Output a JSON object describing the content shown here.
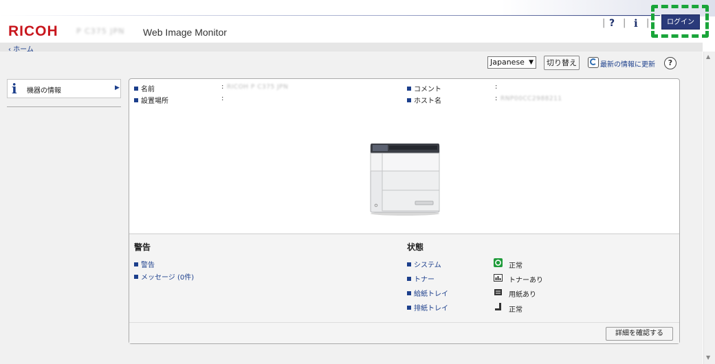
{
  "header": {
    "brand": "RICOH",
    "model": "P C375 JPN",
    "app_title": "Web Image Monitor",
    "help_label": "?",
    "info_label": "i",
    "login_label": "ログイン"
  },
  "breadcrumb": {
    "home": "‹ ホーム"
  },
  "toolbar": {
    "language_selected": "Japanese",
    "switch_label": "切り替え",
    "refresh_label": "最新の情報に更新",
    "help_label": "?"
  },
  "sidebar": {
    "items": [
      {
        "label": "機器の情報",
        "icon": "info-icon"
      }
    ]
  },
  "device": {
    "name_label": "名前",
    "name_value": "RICOH P C375 JPN",
    "location_label": "設置場所",
    "location_value": "",
    "comment_label": "コメント",
    "comment_value": "",
    "host_label": "ホスト名",
    "host_value": "RNP00CC2988211"
  },
  "alerts": {
    "title": "警告",
    "items": [
      "警告",
      "メッセージ (0件)"
    ]
  },
  "status": {
    "title": "状態",
    "rows": [
      {
        "label": "システム",
        "value": "正常",
        "icon": "system-ok-icon"
      },
      {
        "label": "トナー",
        "value": "トナーあり",
        "icon": "toner-icon"
      },
      {
        "label": "給紙トレイ",
        "value": "用紙あり",
        "icon": "paper-tray-icon"
      },
      {
        "label": "排紙トレイ",
        "value": "正常",
        "icon": "output-tray-icon"
      }
    ]
  },
  "details_button": "詳細を確認する",
  "colors": {
    "brand_red": "#c8161d",
    "navy": "#1c3f8c",
    "login_bg": "#2a3a7a",
    "highlight_green": "#1aa53a"
  }
}
